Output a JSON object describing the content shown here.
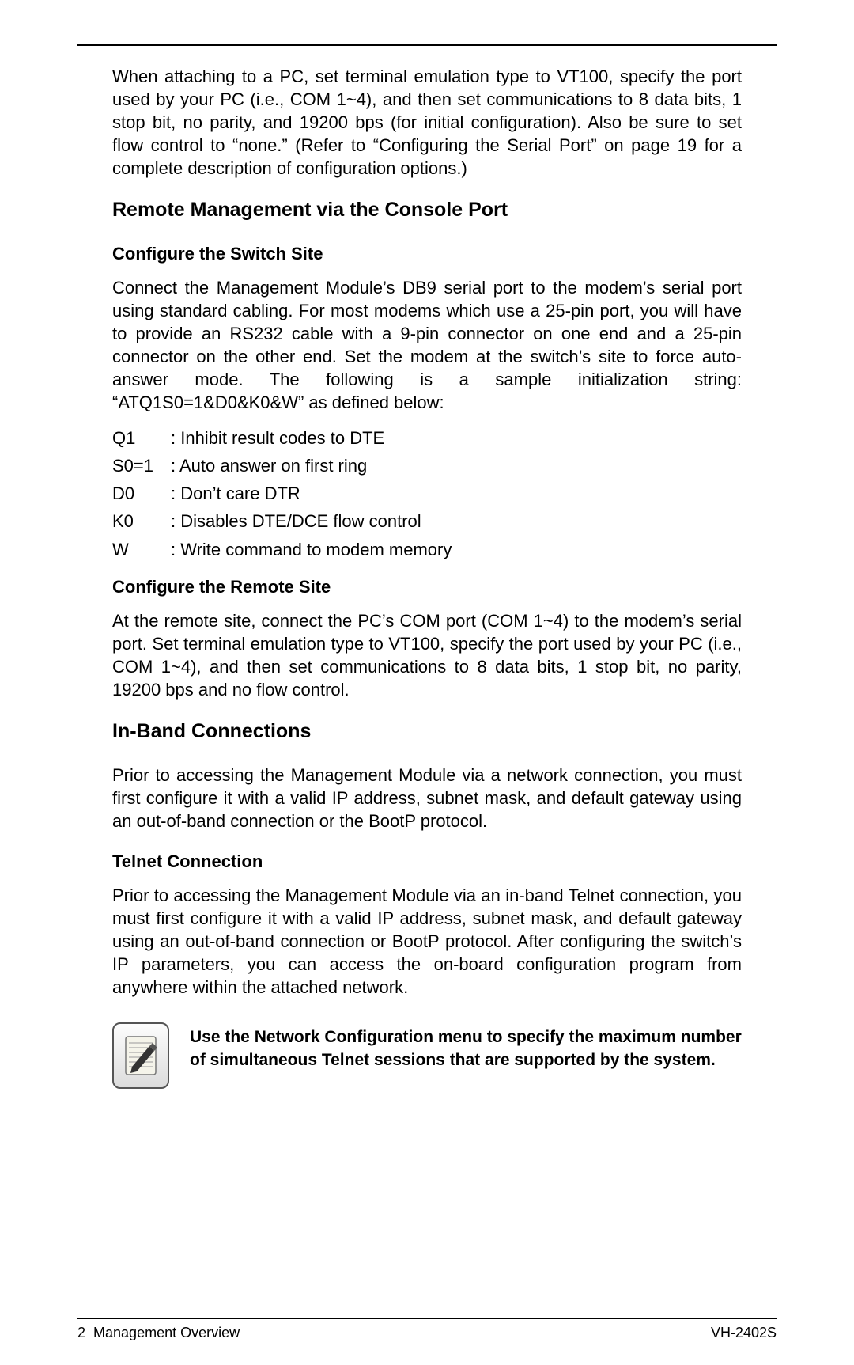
{
  "intro_para": "When attaching to a PC, set terminal emulation type to VT100, specify the port used by your PC (i.e., COM 1~4), and then set communications to 8 data bits, 1 stop bit, no parity, and 19200 bps (for initial configuration). Also be sure to set flow control to “none.” (Refer to “Configuring the Serial Port” on page 19 for a complete description of configuration options.)",
  "section1": {
    "heading": "Remote Management via the Console Port",
    "sub1_heading": "Configure the Switch Site",
    "sub1_para": "Connect the Management Module’s DB9 serial port to the modem’s serial port using standard cabling. For most modems which use a 25-pin port, you will have to provide an RS232 cable with a 9-pin connector on one end and a 25-pin connector on the other end. Set the modem at the switch’s site to force auto-answer mode. The following is a sample initialization string: “ATQ1S0=1&D0&K0&W” as defined below:",
    "defs": [
      {
        "key": "Q1",
        "val": ": Inhibit result codes to DTE"
      },
      {
        "key": "S0=1",
        "val": ": Auto answer on first ring"
      },
      {
        "key": "D0",
        "val": ": Don’t care DTR"
      },
      {
        "key": "K0",
        "val": ": Disables DTE/DCE flow control"
      },
      {
        "key": "W",
        "val": ": Write command to modem memory"
      }
    ],
    "sub2_heading": "Configure the Remote Site",
    "sub2_para": "At the remote site, connect the PC’s COM port (COM 1~4) to the modem’s serial port. Set terminal emulation type to VT100, specify the port used by your PC (i.e., COM 1~4), and then set communications to 8 data bits, 1 stop bit, no parity, 19200 bps and no flow control."
  },
  "section2": {
    "heading": "In-Band Connections",
    "para": "Prior to accessing the Management Module via a network connection, you must first configure it with a valid IP address, subnet mask, and default gateway using an out-of-band connection or the BootP protocol.",
    "sub1_heading": "Telnet Connection",
    "sub1_para": "Prior to accessing the Management Module via an in-band Telnet connection, you must first configure it with a valid IP address, subnet mask, and default gateway using an out-of-band connection or BootP protocol. After configuring the switch’s IP parameters, you can access the on-board configuration program from anywhere within the attached network."
  },
  "note_text": "Use the Network Configuration menu to specify the maximum number of simultaneous Telnet sessions that are supported by the system.",
  "footer": {
    "page_num": "2",
    "section_name": "Management Overview",
    "doc_id": "VH-2402S"
  }
}
